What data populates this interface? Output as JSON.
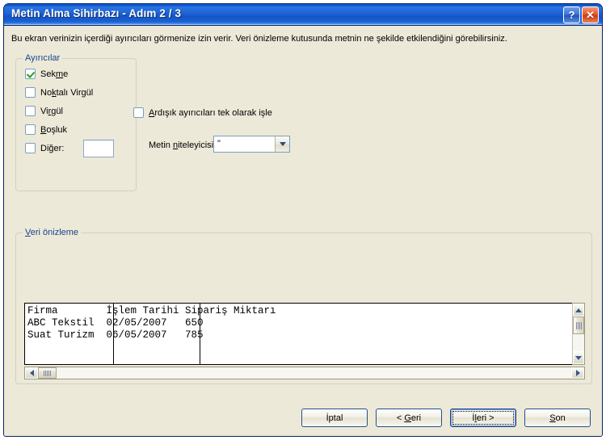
{
  "window": {
    "title": "Metin Alma Sihirbazı - Adım 2 / 3",
    "help_label": "?",
    "close_label": "✕",
    "accent_color": "#1455c4",
    "background_color": "#ece9d8"
  },
  "description": "Bu ekran verinizin içerdiği ayırıcıları görmenize izin verir. Veri önizleme kutusunda metnin ne şekilde etkilendiğini görebilirsiniz.",
  "separators_group": {
    "title": "Ayırıcılar",
    "items": [
      {
        "label_pre": "Sek",
        "label_mnemonic": "m",
        "label_post": "e",
        "checked": true
      },
      {
        "label_pre": "No",
        "label_mnemonic": "k",
        "label_post": "talı Virgül",
        "checked": false
      },
      {
        "label_pre": "Vi",
        "label_mnemonic": "r",
        "label_post": "gül",
        "checked": false
      },
      {
        "label_pre": "",
        "label_mnemonic": "B",
        "label_post": "oşluk",
        "checked": false
      },
      {
        "label_pre": "Di",
        "label_mnemonic": "ğ",
        "label_post": "er:",
        "checked": false
      }
    ],
    "other_value": ""
  },
  "options": {
    "consecutive": {
      "label_pre": "",
      "label_mnemonic": "A",
      "label_post": "rdışık ayırıcıları tek olarak işle",
      "checked": false
    },
    "text_qualifier": {
      "label_pre": "Metin ",
      "label_mnemonic": "n",
      "label_post": "iteleyicisi:",
      "value": "\""
    }
  },
  "preview_group": {
    "title_mnemonic": "V",
    "title_rest": "eri önizleme",
    "lines": [
      "Firma        İşlem Tarihi Sipariş Miktarı",
      "ABC Tekstil  02/05/2007   650",
      "Suat Turizm  06/05/2007   785"
    ],
    "column_separator_positions": [
      109,
      216
    ]
  },
  "buttons": [
    {
      "label_pre": "İptal",
      "label_mnemonic": "",
      "label_post": "",
      "name": "cancel-button",
      "default": false
    },
    {
      "label_pre": "< ",
      "label_mnemonic": "G",
      "label_post": "eri",
      "name": "back-button",
      "default": false
    },
    {
      "label_pre": "İ",
      "label_mnemonic": "l",
      "label_post": "eri >",
      "name": "next-button",
      "default": true
    },
    {
      "label_pre": "",
      "label_mnemonic": "S",
      "label_post": "on",
      "name": "finish-button",
      "default": false
    }
  ]
}
